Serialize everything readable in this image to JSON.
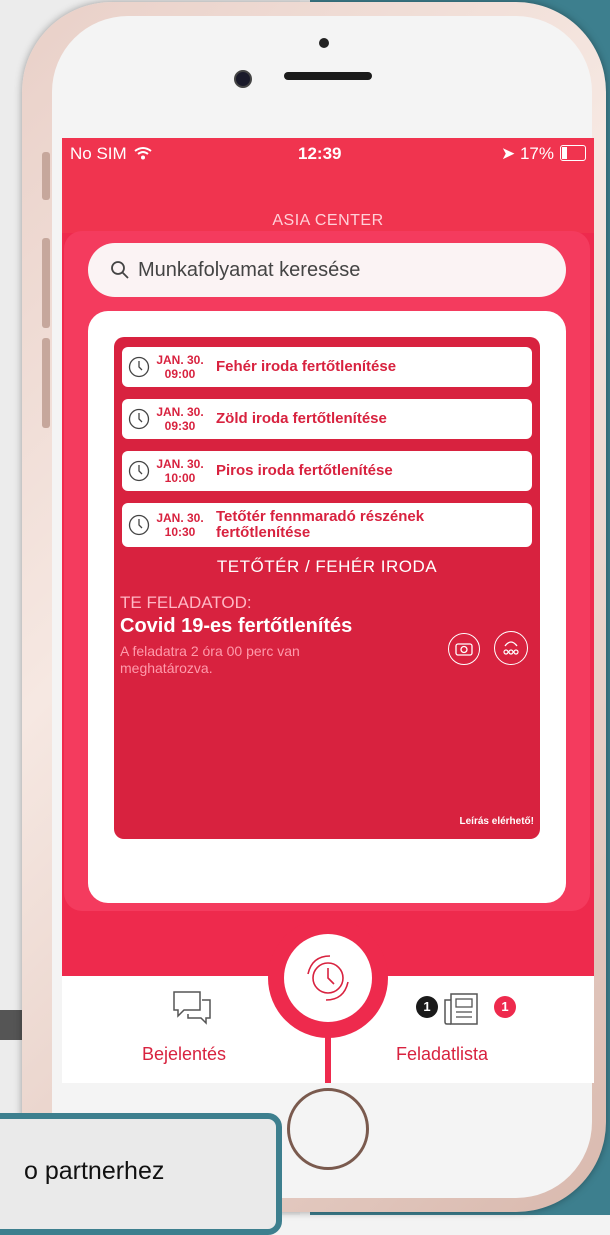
{
  "status_bar": {
    "carrier": "No SIM",
    "time": "12:39",
    "battery": "17%"
  },
  "venue": "ASIA CENTER",
  "search": {
    "placeholder": "Munkafolyamat keresése"
  },
  "tasks": [
    {
      "date": "JAN. 30.",
      "time": "09:00",
      "title": "Fehér iroda fertőtlenítése"
    },
    {
      "date": "JAN. 30.",
      "time": "09:30",
      "title": "Zöld iroda fertőtlenítése"
    },
    {
      "date": "JAN. 30.",
      "time": "10:00",
      "title": "Piros iroda fertőtlenítése"
    },
    {
      "date": "JAN. 30.",
      "time": "10:30",
      "title": "Tetőtér fennmaradó részének fertőtlenítése"
    }
  ],
  "detail": {
    "location": "TETŐTÉR / FEHÉR IRODA",
    "label": "TE FELADATOD:",
    "title": "Covid 19-es fertőtlenítés",
    "description": "A feladatra 2 óra 00 perc van meghatározva.",
    "description_available": "Leírás elérhető!"
  },
  "tabbar": {
    "report_label": "Bejelentés",
    "tasklist_label": "Feladatlista",
    "badge_left": "1",
    "badge_right": "1"
  },
  "tooltip_text": "o partnerhez",
  "colors": {
    "primary": "#ee2a4d",
    "panel": "#d8223f",
    "teal": "#3d7f8e"
  }
}
